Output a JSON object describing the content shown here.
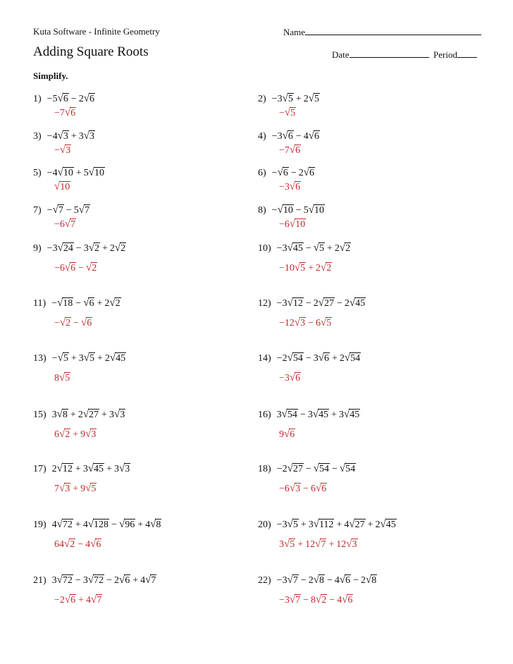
{
  "header": {
    "publisher": "Kuta Software - Infinite Geometry",
    "name_label": "Name",
    "title": "Adding Square Roots",
    "date_label": "Date",
    "period_label": "Period",
    "instructions": "Simplify."
  },
  "colors": {
    "answer": "#c0282d",
    "text": "#111111"
  },
  "problems": [
    {
      "n": "1)",
      "q": [
        [
          "-",
          "5",
          "6"
        ],
        [
          "-",
          "2",
          "6"
        ]
      ],
      "a": [
        [
          "-",
          "7",
          "6"
        ]
      ]
    },
    {
      "n": "2)",
      "q": [
        [
          "-",
          "3",
          "5"
        ],
        [
          "+",
          "2",
          "5"
        ]
      ],
      "a": [
        [
          "-",
          "",
          "5"
        ]
      ]
    },
    {
      "n": "3)",
      "q": [
        [
          "-",
          "4",
          "3"
        ],
        [
          "+",
          "3",
          "3"
        ]
      ],
      "a": [
        [
          "-",
          "",
          "3"
        ]
      ]
    },
    {
      "n": "4)",
      "q": [
        [
          "-",
          "3",
          "6"
        ],
        [
          "-",
          "4",
          "6"
        ]
      ],
      "a": [
        [
          "-",
          "7",
          "6"
        ]
      ]
    },
    {
      "n": "5)",
      "q": [
        [
          "-",
          "4",
          "10"
        ],
        [
          "+",
          "5",
          "10"
        ]
      ],
      "a": [
        [
          "",
          "",
          "10"
        ]
      ]
    },
    {
      "n": "6)",
      "q": [
        [
          "-",
          "",
          "6"
        ],
        [
          "-",
          "2",
          "6"
        ]
      ],
      "a": [
        [
          "-",
          "3",
          "6"
        ]
      ]
    },
    {
      "n": "7)",
      "q": [
        [
          "-",
          "",
          "7"
        ],
        [
          "-",
          "5",
          "7"
        ]
      ],
      "a": [
        [
          "-",
          "6",
          "7"
        ]
      ]
    },
    {
      "n": "8)",
      "q": [
        [
          "-",
          "",
          "10"
        ],
        [
          "-",
          "5",
          "10"
        ]
      ],
      "a": [
        [
          "-",
          "6",
          "10"
        ]
      ]
    },
    {
      "n": "9)",
      "q": [
        [
          "-",
          "3",
          "24"
        ],
        [
          "-",
          "3",
          "2"
        ],
        [
          "+",
          "2",
          "2"
        ]
      ],
      "a": [
        [
          "-",
          "6",
          "6"
        ],
        [
          "-",
          "",
          "2"
        ]
      ]
    },
    {
      "n": "10)",
      "q": [
        [
          "-",
          "3",
          "45"
        ],
        [
          "-",
          "",
          "5"
        ],
        [
          "+",
          "2",
          "2"
        ]
      ],
      "a": [
        [
          "-",
          "10",
          "5"
        ],
        [
          "+",
          "2",
          "2"
        ]
      ]
    },
    {
      "n": "11)",
      "q": [
        [
          "-",
          "",
          "18"
        ],
        [
          "-",
          "",
          "6"
        ],
        [
          "+",
          "2",
          "2"
        ]
      ],
      "a": [
        [
          "-",
          "",
          "2"
        ],
        [
          "-",
          "",
          "6"
        ]
      ]
    },
    {
      "n": "12)",
      "q": [
        [
          "-",
          "3",
          "12"
        ],
        [
          "-",
          "2",
          "27"
        ],
        [
          "-",
          "2",
          "45"
        ]
      ],
      "a": [
        [
          "-",
          "12",
          "3"
        ],
        [
          "-",
          "6",
          "5"
        ]
      ]
    },
    {
      "n": "13)",
      "q": [
        [
          "-",
          "",
          "5"
        ],
        [
          "+",
          "3",
          "5"
        ],
        [
          "+",
          "2",
          "45"
        ]
      ],
      "a": [
        [
          "",
          "8",
          "5"
        ]
      ]
    },
    {
      "n": "14)",
      "q": [
        [
          "-",
          "2",
          "54"
        ],
        [
          "-",
          "3",
          "6"
        ],
        [
          "+",
          "2",
          "54"
        ]
      ],
      "a": [
        [
          "-",
          "3",
          "6"
        ]
      ]
    },
    {
      "n": "15)",
      "q": [
        [
          "",
          "3",
          "8"
        ],
        [
          "+",
          "2",
          "27"
        ],
        [
          "+",
          "3",
          "3"
        ]
      ],
      "a": [
        [
          "",
          "6",
          "2"
        ],
        [
          "+",
          "9",
          "3"
        ]
      ]
    },
    {
      "n": "16)",
      "q": [
        [
          "",
          "3",
          "54"
        ],
        [
          "-",
          "3",
          "45"
        ],
        [
          "+",
          "3",
          "45"
        ]
      ],
      "a": [
        [
          "",
          "9",
          "6"
        ]
      ]
    },
    {
      "n": "17)",
      "q": [
        [
          "",
          "2",
          "12"
        ],
        [
          "+",
          "3",
          "45"
        ],
        [
          "+",
          "3",
          "3"
        ]
      ],
      "a": [
        [
          "",
          "7",
          "3"
        ],
        [
          "+",
          "9",
          "5"
        ]
      ]
    },
    {
      "n": "18)",
      "q": [
        [
          "-",
          "2",
          "27"
        ],
        [
          "-",
          "",
          "54"
        ],
        [
          "-",
          "",
          "54"
        ]
      ],
      "a": [
        [
          "-",
          "6",
          "3"
        ],
        [
          "-",
          "6",
          "6"
        ]
      ]
    },
    {
      "n": "19)",
      "q": [
        [
          "",
          "4",
          "72"
        ],
        [
          "+",
          "4",
          "128"
        ],
        [
          "-",
          "",
          "96"
        ],
        [
          "+",
          "4",
          "8"
        ]
      ],
      "a": [
        [
          "",
          "64",
          "2"
        ],
        [
          "-",
          "4",
          "6"
        ]
      ]
    },
    {
      "n": "20)",
      "q": [
        [
          "-",
          "3",
          "5"
        ],
        [
          "+",
          "3",
          "112"
        ],
        [
          "+",
          "4",
          "27"
        ],
        [
          "+",
          "2",
          "45"
        ]
      ],
      "a": [
        [
          "",
          "3",
          "5"
        ],
        [
          "+",
          "12",
          "7"
        ],
        [
          "+",
          "12",
          "3"
        ]
      ]
    },
    {
      "n": "21)",
      "q": [
        [
          "",
          "3",
          "72"
        ],
        [
          "-",
          "3",
          "72"
        ],
        [
          "-",
          "2",
          "6"
        ],
        [
          "+",
          "4",
          "7"
        ]
      ],
      "a": [
        [
          "-",
          "2",
          "6"
        ],
        [
          "+",
          "4",
          "7"
        ]
      ]
    },
    {
      "n": "22)",
      "q": [
        [
          "-",
          "3",
          "7"
        ],
        [
          "-",
          "2",
          "8"
        ],
        [
          "-",
          "4",
          "6"
        ],
        [
          "-",
          "2",
          "8"
        ]
      ],
      "a": [
        [
          "-",
          "3",
          "7"
        ],
        [
          "-",
          "8",
          "2"
        ],
        [
          "-",
          "4",
          "6"
        ]
      ]
    }
  ]
}
